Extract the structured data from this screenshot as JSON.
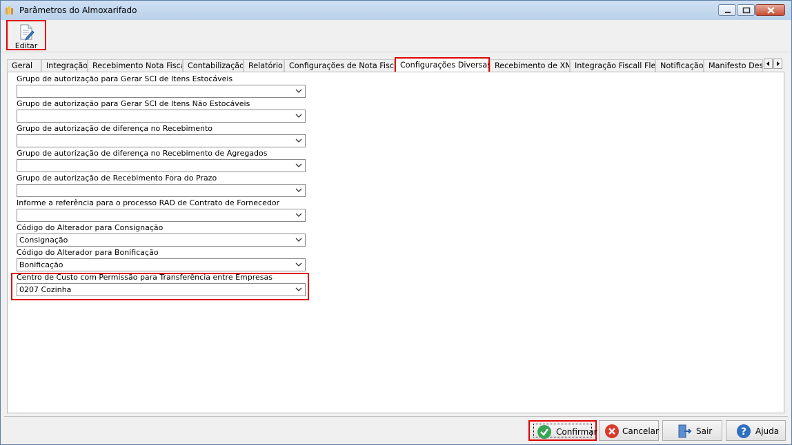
{
  "window": {
    "title": "Parâmetros do Almoxarifado"
  },
  "toolbar": {
    "edit_label": "Editar"
  },
  "tabs": [
    {
      "label": "Geral"
    },
    {
      "label": "Integração"
    },
    {
      "label": "Recebimento Nota Fiscal"
    },
    {
      "label": "Contabilização"
    },
    {
      "label": "Relatório"
    },
    {
      "label": "Configurações de Nota Fiscal"
    },
    {
      "label": "Configurações Diversas",
      "active": true
    },
    {
      "label": "Recebimento de XML"
    },
    {
      "label": "Integração Fiscall Flex"
    },
    {
      "label": "Notificação"
    },
    {
      "label": "Manifesto Dest"
    }
  ],
  "fields": [
    {
      "label": "Grupo de autorização para Gerar SCI de Itens Estocáveis",
      "value": ""
    },
    {
      "label": "Grupo de autorização para Gerar SCI de Itens Não Estocáveis",
      "value": ""
    },
    {
      "label": "Grupo de autorização de diferença no Recebimento",
      "value": ""
    },
    {
      "label": "Grupo de autorização de diferença no Recebimento de Agregados",
      "value": ""
    },
    {
      "label": "Grupo de autorização de Recebimento Fora do Prazo",
      "value": ""
    },
    {
      "label": "Informe a referência para o processo RAD de Contrato de Fornecedor",
      "value": ""
    },
    {
      "label": "Código do Alterador para Consignação",
      "value": "Consignação"
    },
    {
      "label": "Código do Alterador para Bonificação",
      "value": "Bonificação"
    },
    {
      "label": "Centro de Custo com Permissão para Transferência entre Empresas",
      "value": "0207 Cozinha"
    }
  ],
  "footer": {
    "confirm_label": "Confirmar",
    "cancel_label": "Cancelar",
    "exit_label": "Sair",
    "help_label": "Ajuda"
  },
  "colors": {
    "highlight": "#e00000",
    "confirm_icon": "#3aa557",
    "cancel_icon": "#d93a2b",
    "help_icon": "#2f6fc1"
  }
}
